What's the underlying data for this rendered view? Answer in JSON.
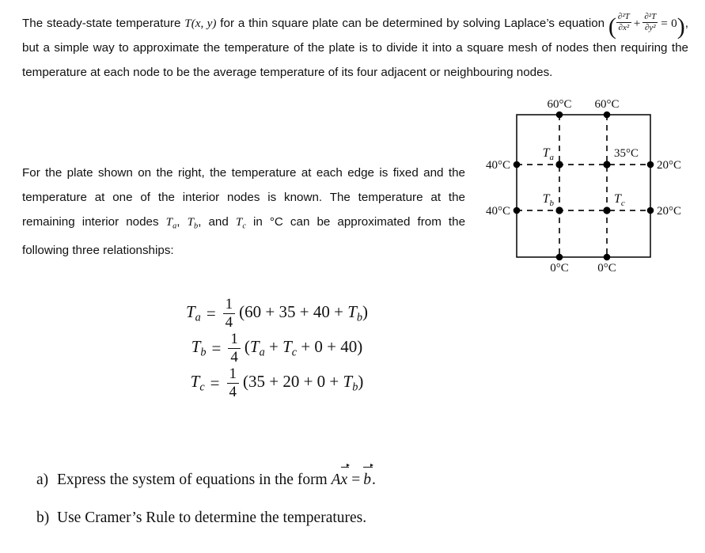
{
  "document": {
    "paragraphs": [
      {
        "id": "intro",
        "segments": {
          "p1_a": "The steady-state temperature ",
          "p1_T": "T",
          "p1_args": "(x, y)",
          "p1_b": " for a thin square plate can be determined by solving Laplace’s equation ",
          "frac1_num": "∂²T",
          "frac1_den": "∂x²",
          "plus": "+",
          "frac2_num": "∂²T",
          "frac2_den": "∂y²",
          "equals_zero": "= 0",
          "p1_c": ", but a simple way to approximate the temperature of the plate is to divide it into a square mesh of nodes then requiring the temperature at each node to be the average temperature of its four adjacent or neighbouring nodes."
        }
      },
      {
        "id": "setup",
        "segments": {
          "p2_a": "For the plate shown on the right, the temperature at each edge is fixed and the temperature at one of the interior nodes is known.  The temperature at the remaining interior nodes ",
          "p2_Ta": "T",
          "p2_Ta_sub": "a",
          "p2_b": ", ",
          "p2_Tb": "T",
          "p2_Tb_sub": "b",
          "p2_c": ", and ",
          "p2_Tc": "T",
          "p2_Tc_sub": "c",
          "p2_d": " in °C can be approximated from the following three relationships:"
        }
      }
    ],
    "equations": [
      {
        "lhs": "T",
        "lhs_sub": "a",
        "eq": "=",
        "frac_num": "1",
        "frac_den": "4",
        "rhs_pre": "(60 + 35 + 40 + ",
        "rhs_var": "T",
        "rhs_var_sub": "b",
        "rhs_post": ")"
      },
      {
        "lhs": "T",
        "lhs_sub": "b",
        "eq": "=",
        "frac_num": "1",
        "frac_den": "4",
        "rhs_pre": "(",
        "rhs_var": "T",
        "rhs_var_sub": "a",
        "rhs_mid": " + ",
        "rhs_var2": "T",
        "rhs_var2_sub": "c",
        "rhs_post": " + 0 + 40)"
      },
      {
        "lhs": "T",
        "lhs_sub": "c",
        "eq": "=",
        "frac_num": "1",
        "frac_den": "4",
        "rhs_pre": "(35 + 20 + 0 + ",
        "rhs_var": "T",
        "rhs_var_sub": "b",
        "rhs_post": ")"
      }
    ],
    "questions": [
      {
        "label": "a)",
        "text_pre": "Express the system of equations in the form ",
        "matrix": "A",
        "vec_x": "x",
        "eq": "=",
        "vec_b": "b",
        "text_post": "."
      },
      {
        "label": "b)",
        "text_pre": "Use Cramer’s Rule to determine the temperatures.",
        "matrix": "",
        "vec_x": "",
        "eq": "",
        "vec_b": "",
        "text_post": ""
      }
    ]
  },
  "diagram": {
    "title": "square-plate-node-mesh",
    "stroke_color": "#111111",
    "node_color": "#000000",
    "boundary_labels": {
      "top_left": "60°C",
      "top_right": "60°C",
      "left_upper": "40°C",
      "left_lower": "40°C",
      "right_upper": "20°C",
      "right_lower": "20°C",
      "bottom_left": "0°C",
      "bottom_right": "0°C"
    },
    "interior_labels": {
      "node_a": "T",
      "node_a_sub": "a",
      "node_known": "35°C",
      "node_b": "T",
      "node_b_sub": "b",
      "node_c": "T",
      "node_c_sub": "c"
    }
  }
}
